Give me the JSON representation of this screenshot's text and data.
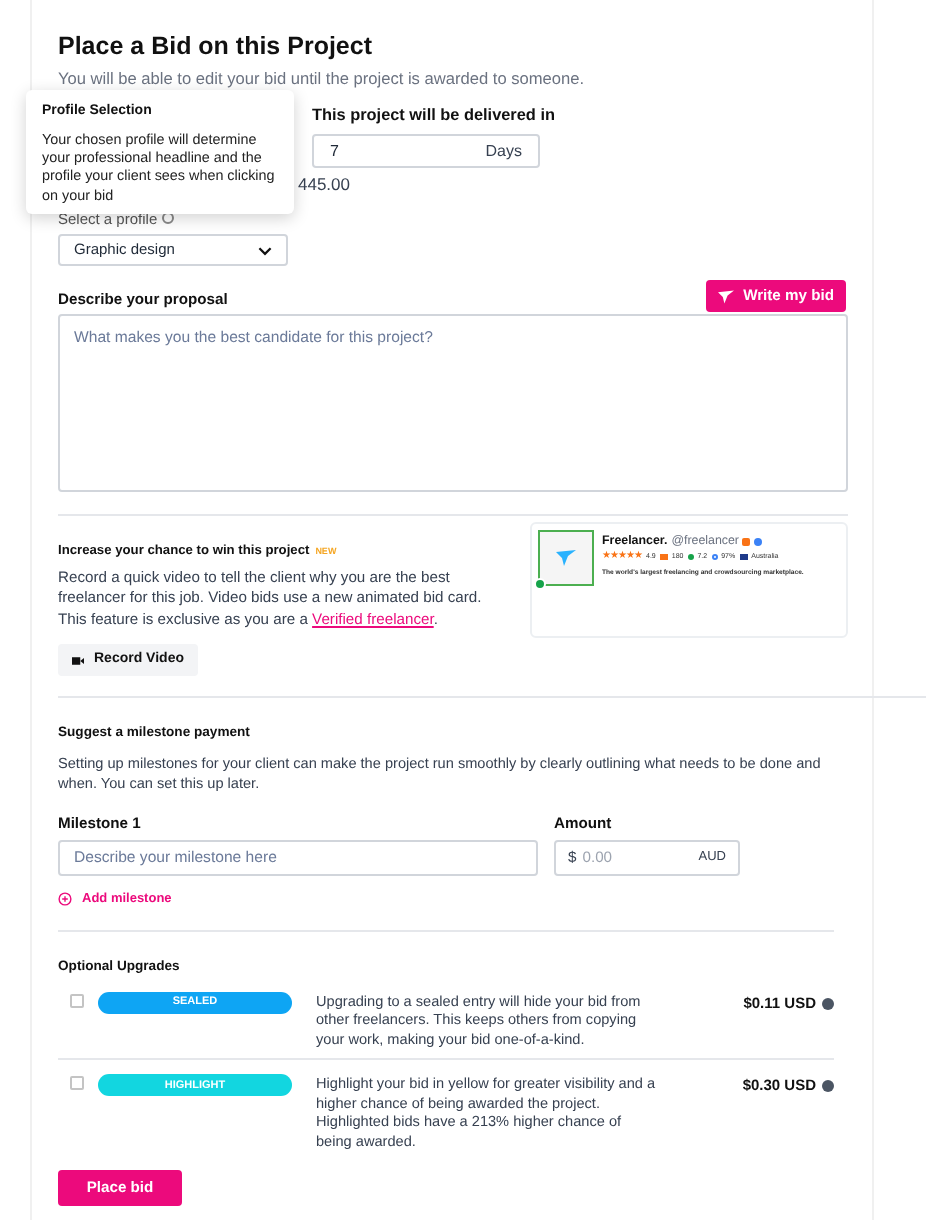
{
  "title": "Place a Bid on this Project",
  "subtitle": "You will be able to edit your bid until the project is awarded to someone.",
  "tooltip": {
    "title": "Profile Selection",
    "body": "Your chosen profile will determine your professional headline and the profile your client sees when clicking on your bid"
  },
  "delivery": {
    "label": "This project will be delivered in",
    "value": "7",
    "unit": "Days"
  },
  "bid_amount": "445.00",
  "profile": {
    "label": "Select a profile",
    "value": "Graphic design"
  },
  "proposal": {
    "label": "Describe your proposal",
    "placeholder": "What makes you the best candidate for this project?",
    "ai_button": "Write my bid"
  },
  "video": {
    "title": "Increase your chance to win this project",
    "badge": "NEW",
    "text": "Record a quick video to tell the client why you are the best freelancer for this job. Video bids use a new animated bid card. This feature is exclusive as you are a ",
    "link": "Verified freelancer",
    "text_after": ".",
    "button": "Record Video"
  },
  "bid_card": {
    "name": "Freelancer.",
    "handle": "@freelancer",
    "stars": 5,
    "rating": "4.9",
    "reviews": "180",
    "score": "7.2",
    "percent": "97%",
    "country": "Australia",
    "tagline": "The world's largest freelancing and crowdsourcing marketplace."
  },
  "milestone": {
    "title": "Suggest a milestone payment",
    "text": "Setting up milestones for your client can make the project run smoothly by clearly outlining what needs to be done and when. You can set this up later.",
    "label": "Milestone 1",
    "placeholder": "Describe your milestone here",
    "amount_label": "Amount",
    "currency_symbol": "$",
    "amount_placeholder": "0.00",
    "currency": "AUD",
    "add_label": "Add milestone"
  },
  "upgrades": {
    "title": "Optional Upgrades",
    "items": [
      {
        "label": "SEALED",
        "color": "#0ea5f4",
        "checked": false,
        "text": "Upgrading to a sealed entry will hide your bid from other freelancers. This keeps others from copying your work, making your bid one-of-a-kind.",
        "price": "$0.11 USD"
      },
      {
        "label": "HIGHLIGHT",
        "color": "#12d6e0",
        "checked": false,
        "text": "Highlight your bid in yellow for greater visibility and a higher chance of being awarded the project. Highlighted bids have a 213% higher chance of being awarded.",
        "price": "$0.30 USD"
      }
    ]
  },
  "submit": "Place bid"
}
